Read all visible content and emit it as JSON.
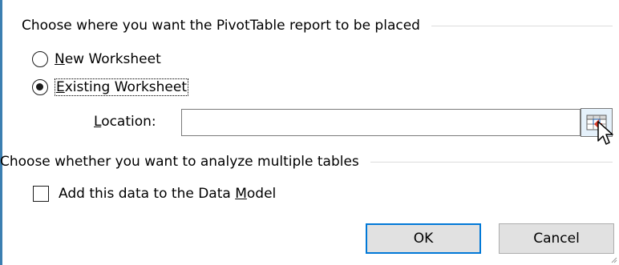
{
  "placement_group": {
    "title": "Choose where you want the PivotTable report to be placed",
    "options": [
      {
        "label_accel": "N",
        "label_rest": "ew Worksheet",
        "selected": false
      },
      {
        "label_accel": "E",
        "label_rest": "xisting Worksheet",
        "selected": true
      }
    ],
    "location": {
      "label_accel": "L",
      "label_rest": "ocation:",
      "value": ""
    }
  },
  "analysis_group": {
    "title": "Choose whether you want to analyze multiple tables",
    "checkbox": {
      "label_before": "Add this data to the Data ",
      "label_accel": "M",
      "label_after": "odel",
      "checked": false
    }
  },
  "buttons": {
    "ok": "OK",
    "cancel": "Cancel"
  },
  "colors": {
    "accent": "#0078d7",
    "window_border": "#3c7fb1",
    "button_face": "#e1e1e1"
  },
  "icons": [
    "range-selector-icon",
    "mouse-pointer-icon",
    "resize-grip-icon"
  ]
}
